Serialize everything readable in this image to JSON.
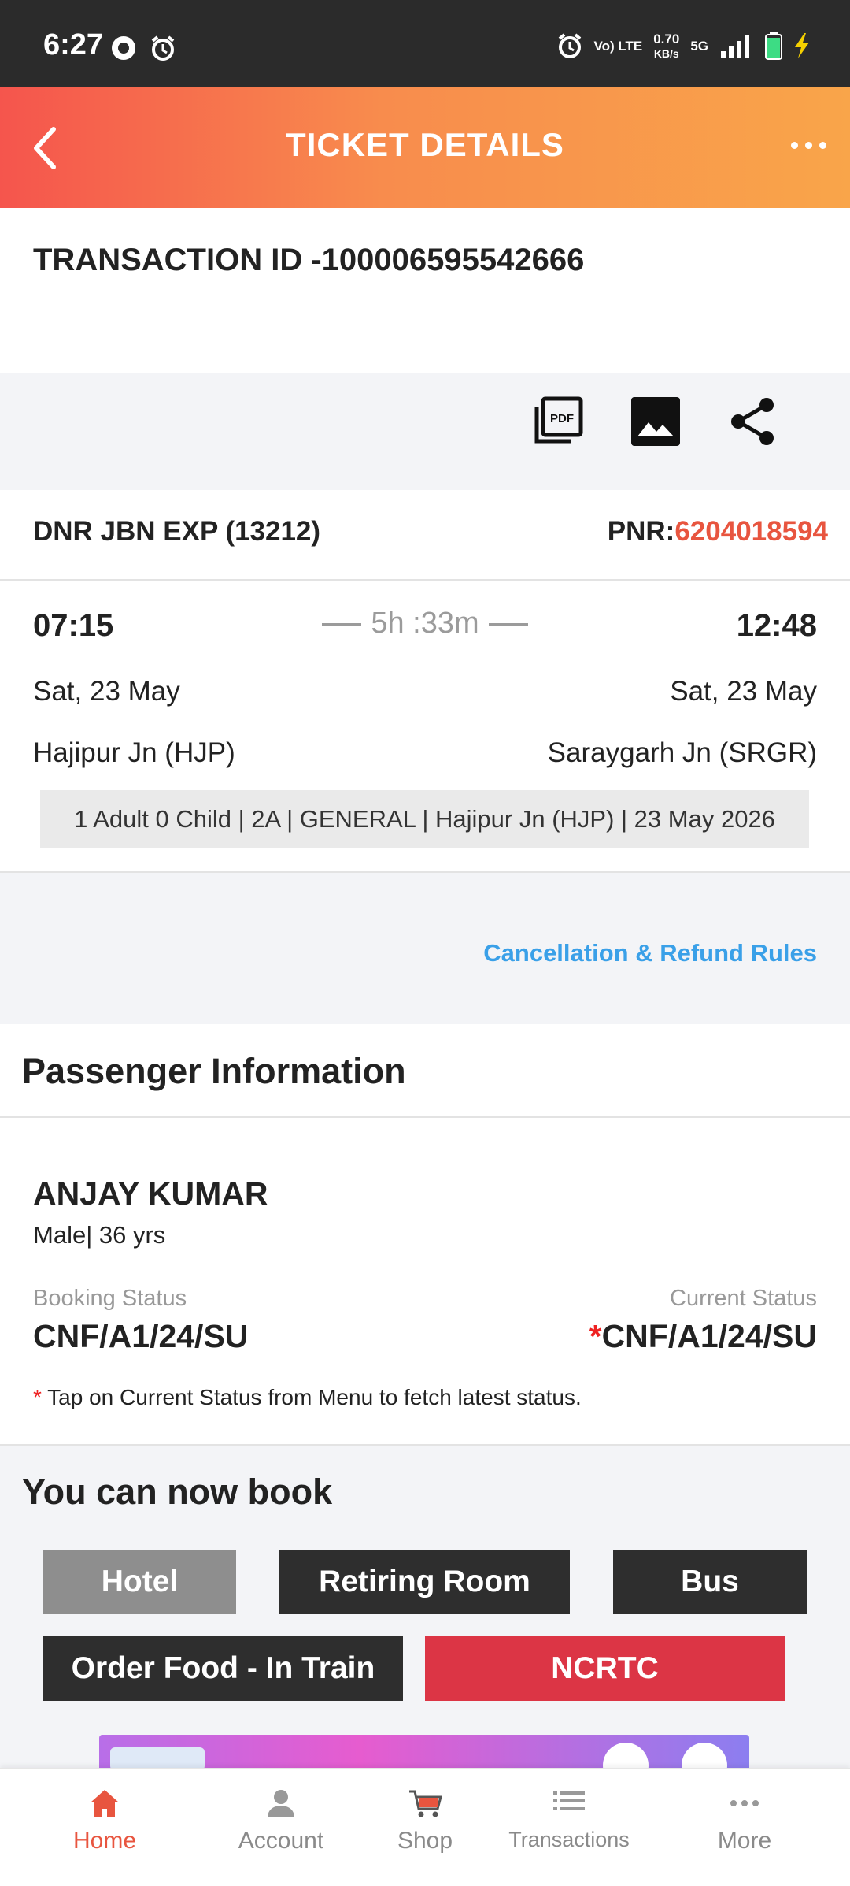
{
  "status_bar": {
    "time": "6:27",
    "volte": "Vo) LTE",
    "speed": "0.70",
    "speed_unit": "KB/s",
    "network": "5G"
  },
  "header": {
    "title": "TICKET DETAILS"
  },
  "transaction": {
    "label": "TRANSACTION ID -100006595542666"
  },
  "actions": {
    "icons": [
      "pdf-icon",
      "image-icon",
      "share-icon"
    ]
  },
  "train": {
    "name": "DNR JBN EXP  (13212)",
    "pnr_label": "PNR:",
    "pnr_value": "6204018594"
  },
  "journey": {
    "departure_time": "07:15",
    "arrival_time": "12:48",
    "duration": "5h :33m",
    "departure_date": "Sat, 23 May",
    "arrival_date": "Sat, 23 May",
    "from_station": "Hajipur Jn (HJP)",
    "to_station": "Saraygarh Jn (SRGR)",
    "summary": "1 Adult 0 Child  | 2A | GENERAL | Hajipur Jn (HJP) | 23 May 2026"
  },
  "links": {
    "cancellation": "Cancellation & Refund Rules"
  },
  "passenger": {
    "section_title": "Passenger Information",
    "name": "ANJAY KUMAR",
    "meta": "Male| 36 yrs",
    "booking_status_label": "Booking Status",
    "booking_status": "CNF/A1/24/SU",
    "current_status_label": "Current Status",
    "current_status_star": "*",
    "current_status": "CNF/A1/24/SU",
    "note_star": "*",
    "note": " Tap on Current Status from Menu to fetch latest status."
  },
  "book": {
    "title": "You can now book",
    "hotel": "Hotel",
    "retiring_room": "Retiring Room",
    "bus": "Bus",
    "order_food": "Order Food - In Train",
    "ncrtc": "NCRTC"
  },
  "colors": {
    "accent": "#e8553f",
    "link": "#3aa0e8",
    "ncrtc": "#dc3545",
    "button_dark": "#2e2e2e",
    "button_gray": "#8e8e8e"
  },
  "nav": {
    "home": "Home",
    "account": "Account",
    "shop": "Shop",
    "transactions": "Transactions",
    "more": "More"
  }
}
